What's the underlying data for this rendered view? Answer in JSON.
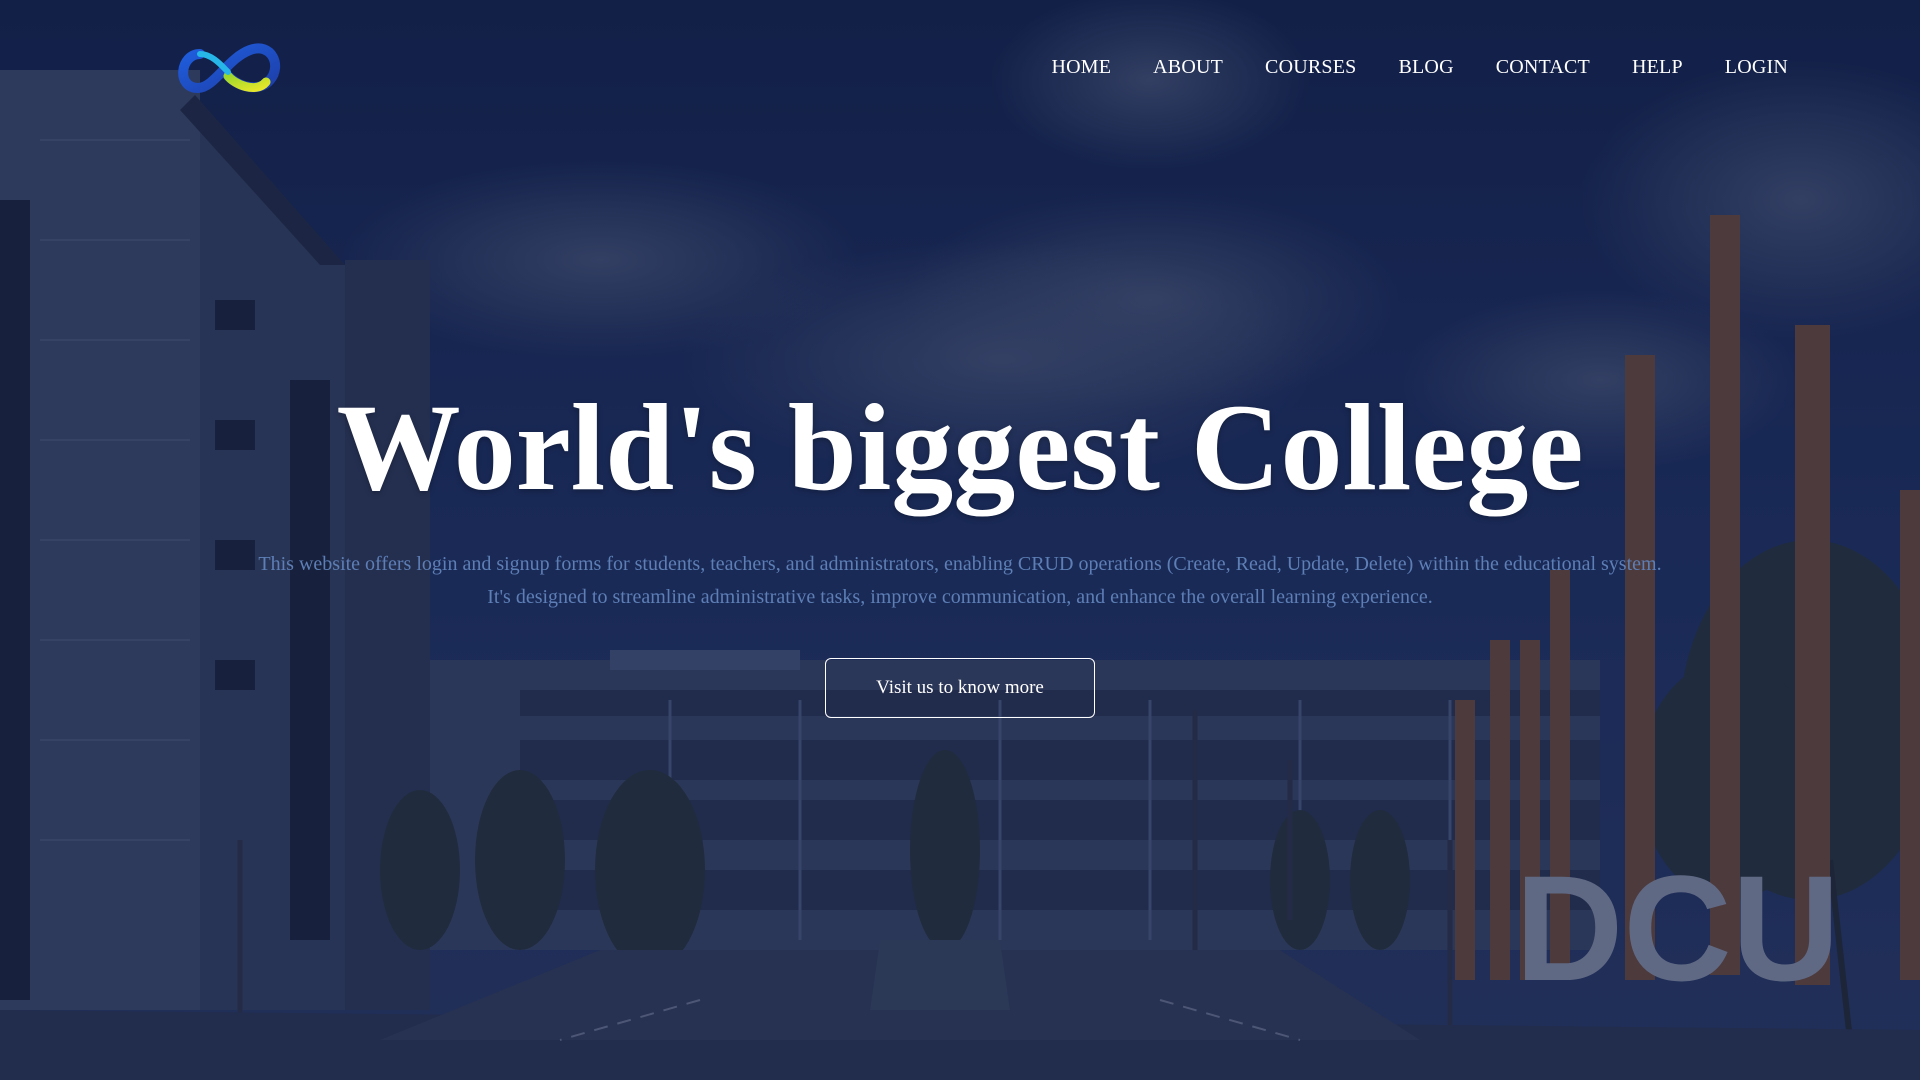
{
  "logo": {
    "icon": "infinity-logo-icon"
  },
  "nav": {
    "items": [
      {
        "label": "HOME"
      },
      {
        "label": "ABOUT"
      },
      {
        "label": "COURSES"
      },
      {
        "label": "BLOG"
      },
      {
        "label": "CONTACT"
      },
      {
        "label": "HELP"
      },
      {
        "label": "LOGIN"
      }
    ]
  },
  "hero": {
    "title": "World's biggest College",
    "description_line1": "This website offers login and signup forms for students, teachers, and administrators, enabling CRUD operations (Create, Read, Update, Delete) within the educational system.",
    "description_line2": "It's designed to streamline administrative tasks, improve communication, and enhance the overall learning experience.",
    "cta_label": "Visit us to know more",
    "sign_text": "DCU"
  },
  "colors": {
    "overlay": "#1c2d57",
    "description_text": "#5d7fb6",
    "heading_text": "#ffffff"
  }
}
